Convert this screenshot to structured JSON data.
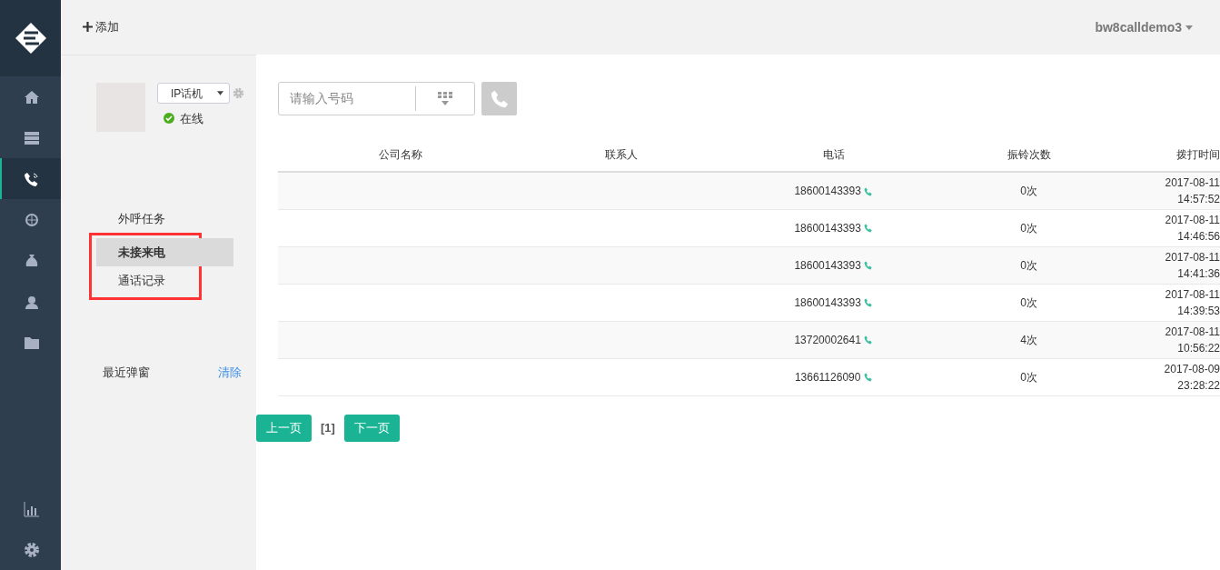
{
  "sidebar": {
    "items": [
      {
        "selected": false
      },
      {
        "selected": false
      },
      {
        "selected": true
      },
      {
        "selected": false
      },
      {
        "selected": false
      },
      {
        "selected": false
      },
      {
        "selected": false
      }
    ],
    "bottom_items": [
      {
        "selected": false
      },
      {
        "selected": false
      }
    ]
  },
  "topbar": {
    "add_label": "添加",
    "user": "bw8calldemo3"
  },
  "agent": {
    "device": "IP话机",
    "status": "在线",
    "online": true
  },
  "menu": [
    {
      "label": "外呼任务",
      "selected": false,
      "annotated": false
    },
    {
      "label": "未接来电",
      "selected": true,
      "annotated": true
    },
    {
      "label": "通话记录",
      "selected": false,
      "annotated": true
    }
  ],
  "recent": {
    "label": "最近弹窗",
    "clear": "清除"
  },
  "dialer": {
    "placeholder": "请输入号码"
  },
  "table": {
    "columns": [
      "公司名称",
      "联系人",
      "电话",
      "振铃次数",
      "拨打时间"
    ],
    "rows": [
      {
        "phone": "18600143393",
        "rings": "0次",
        "date": "2017-08-11",
        "time": "14:57:52"
      },
      {
        "phone": "18600143393",
        "rings": "0次",
        "date": "2017-08-11",
        "time": "14:46:56"
      },
      {
        "phone": "18600143393",
        "rings": "0次",
        "date": "2017-08-11",
        "time": "14:41:36"
      },
      {
        "phone": "18600143393",
        "rings": "0次",
        "date": "2017-08-11",
        "time": "14:39:53"
      },
      {
        "phone": "13720002641",
        "rings": "4次",
        "date": "2017-08-11",
        "time": "10:56:22"
      },
      {
        "phone": "13661126090",
        "rings": "0次",
        "date": "2017-08-09",
        "time": "23:28:22"
      }
    ]
  },
  "pager": {
    "prev": "上一页",
    "page": "[1]",
    "next": "下一页"
  }
}
